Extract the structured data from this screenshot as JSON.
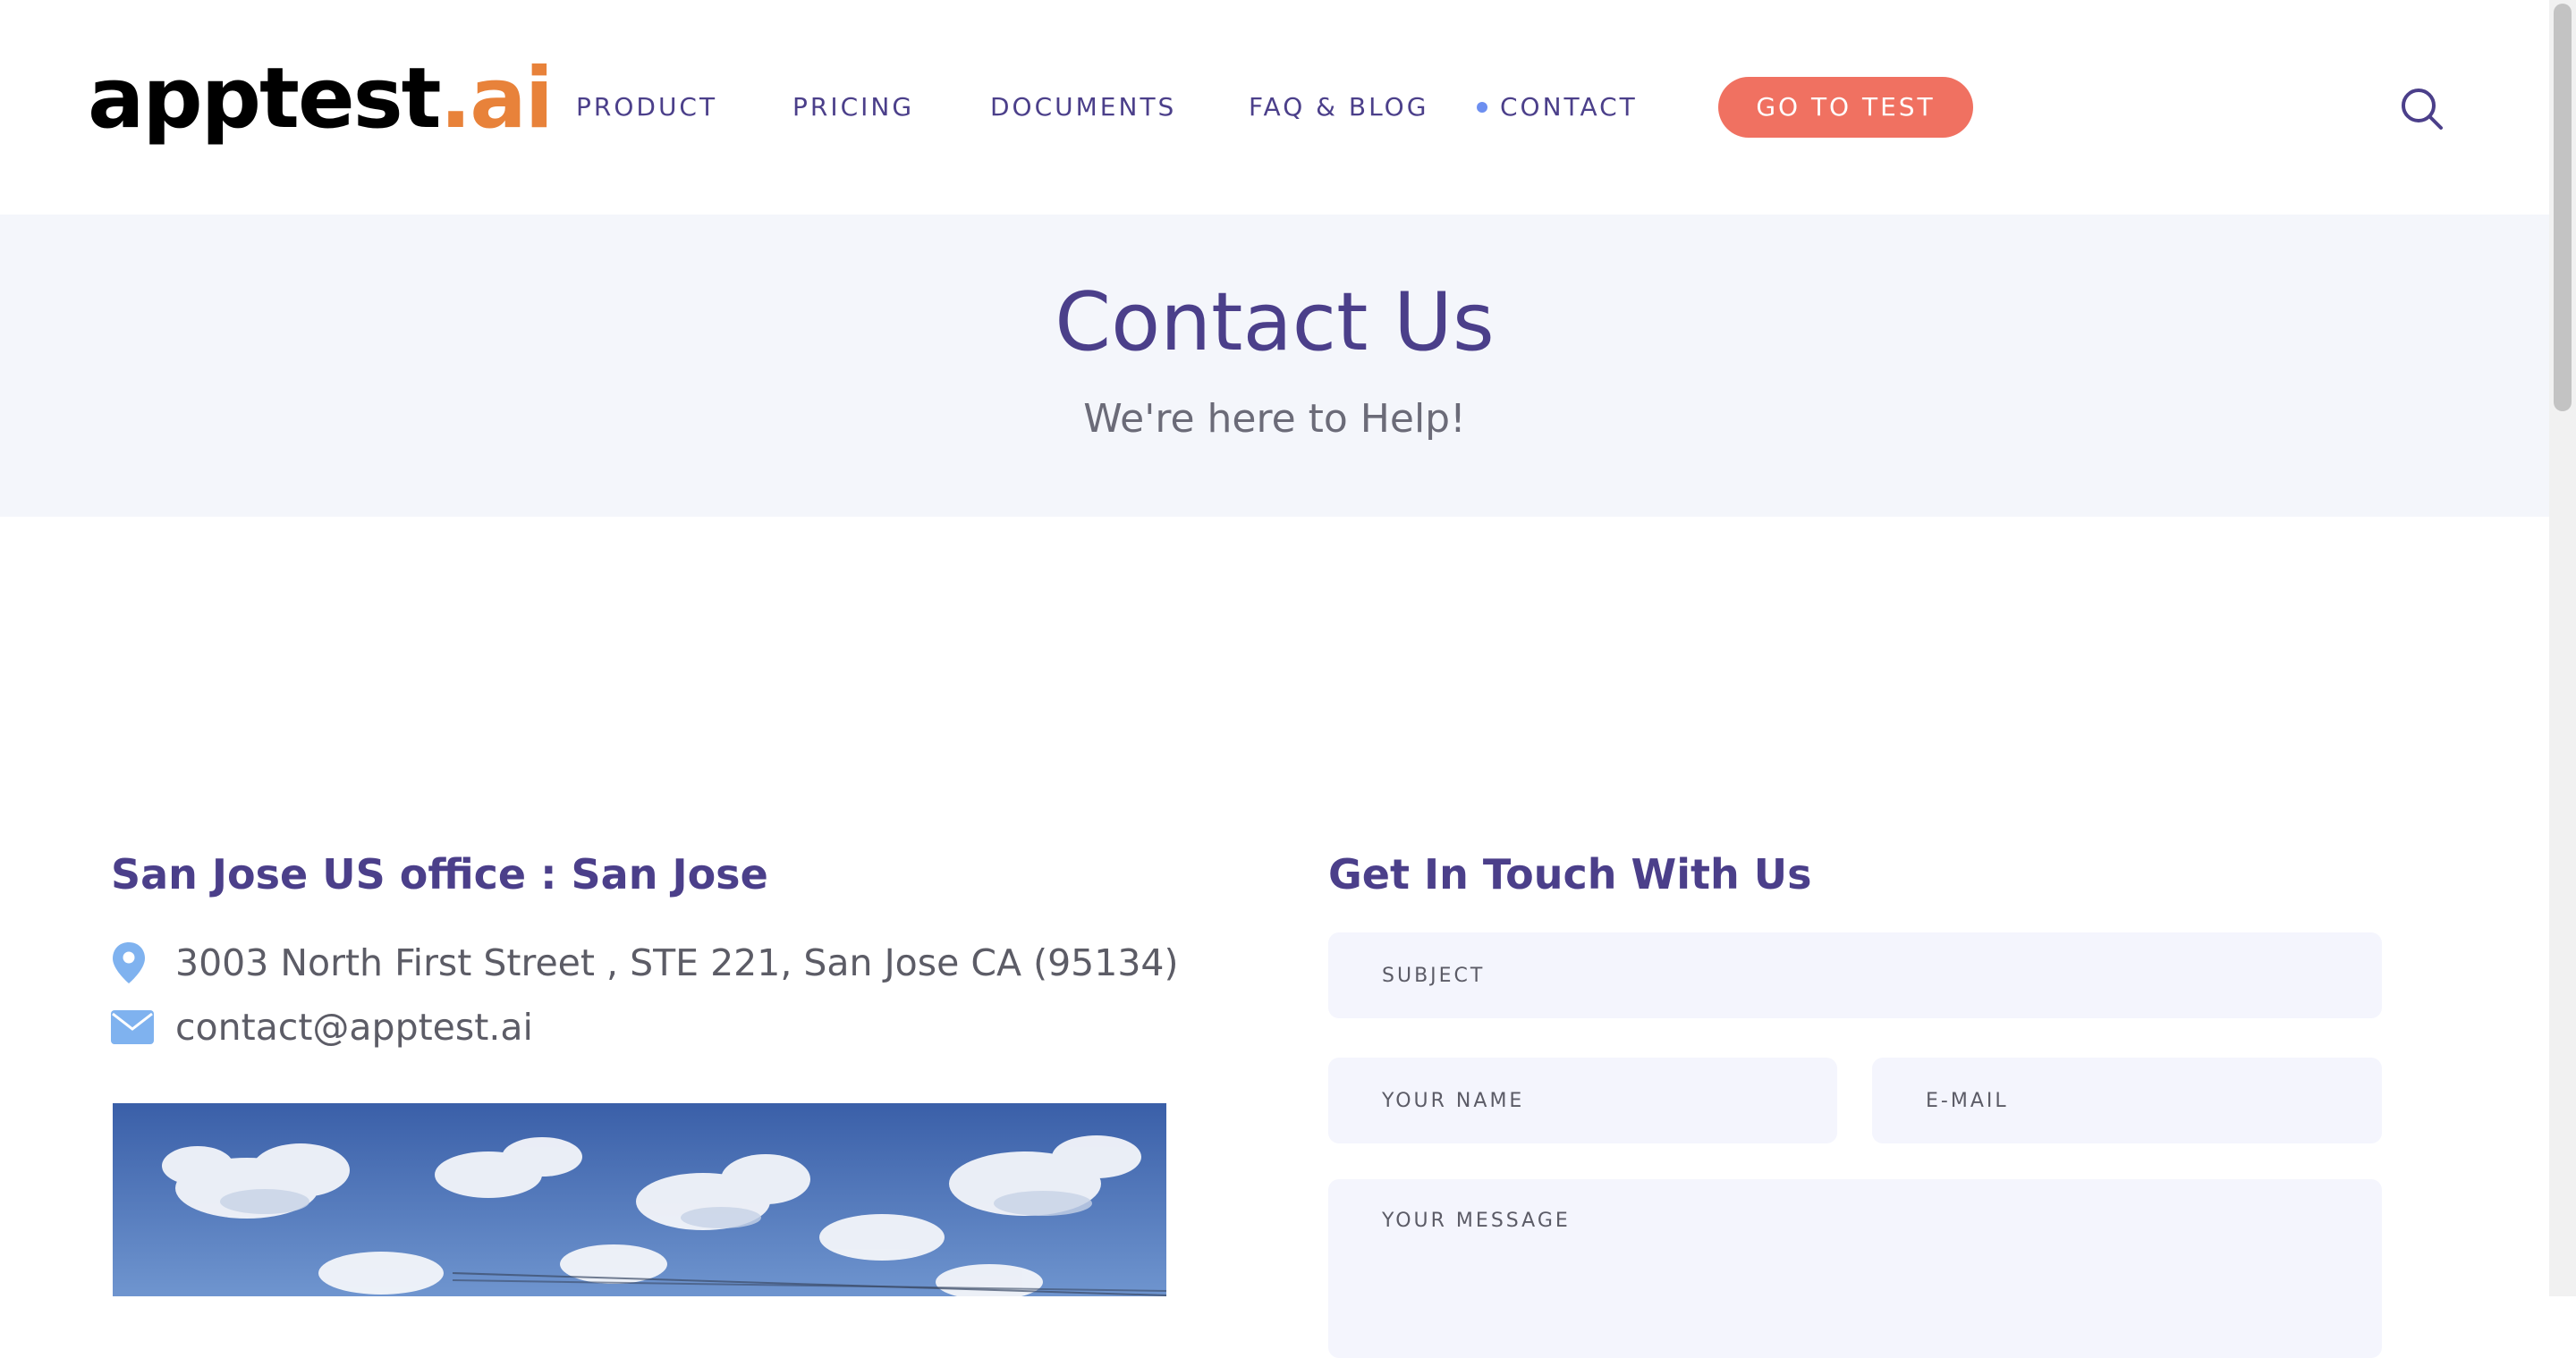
{
  "header": {
    "logo_main": "apptest",
    "logo_accent": ".ai",
    "nav": [
      {
        "label": "PRODUCT"
      },
      {
        "label": "PRICING"
      },
      {
        "label": "DOCUMENTS"
      },
      {
        "label": "FAQ & BLOG"
      },
      {
        "label": "CONTACT",
        "active": true
      }
    ],
    "cta_label": "GO TO TEST",
    "search_icon": "search-icon"
  },
  "hero": {
    "title": "Contact Us",
    "subtitle": "We're here to Help!"
  },
  "office": {
    "title": "San Jose US office : San Jose",
    "address": "3003 North First Street , STE 221, San Jose CA (95134)",
    "email": "contact@apptest.ai",
    "address_icon": "map-pin-icon",
    "email_icon": "envelope-icon"
  },
  "form": {
    "title": "Get In Touch With Us",
    "subject_placeholder": "SUBJECT",
    "name_placeholder": "YOUR NAME",
    "email_placeholder": "E-MAIL",
    "message_placeholder": "YOUR MESSAGE"
  },
  "colors": {
    "brand_purple": "#4b3f8a",
    "accent_orange": "#e8823a",
    "cta_coral": "#f07161",
    "icon_blue": "#7fb2ef",
    "hero_bg": "#f4f6fb",
    "field_bg": "#f4f5fd"
  }
}
